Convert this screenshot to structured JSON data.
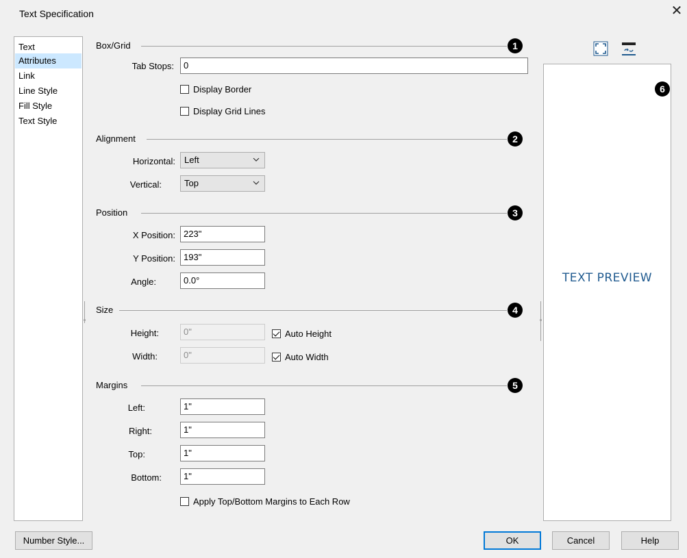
{
  "window": {
    "title": "Text Specification",
    "close_glyph": "✕"
  },
  "sidebar": {
    "items": [
      {
        "label": "Text"
      },
      {
        "label": "Attributes",
        "selected": true
      },
      {
        "label": "Link"
      },
      {
        "label": "Line Style"
      },
      {
        "label": "Fill Style"
      },
      {
        "label": "Text Style"
      }
    ]
  },
  "box_grid": {
    "heading": "Box/Grid",
    "badge": "1",
    "tab_stops_label": "Tab Stops:",
    "tab_stops_value": "0",
    "display_border_label": "Display Border",
    "display_border_checked": false,
    "display_grid_lines_label": "Display Grid Lines",
    "display_grid_lines_checked": false
  },
  "alignment": {
    "heading": "Alignment",
    "badge": "2",
    "horizontal_label": "Horizontal:",
    "horizontal_value": "Left",
    "vertical_label": "Vertical:",
    "vertical_value": "Top"
  },
  "position": {
    "heading": "Position",
    "badge": "3",
    "x_label": "X Position:",
    "x_value": "223\"",
    "y_label": "Y Position:",
    "y_value": "193\"",
    "angle_label": "Angle:",
    "angle_value": "0.0°"
  },
  "size": {
    "heading": "Size",
    "badge": "4",
    "height_label": "Height:",
    "height_value": "0\"",
    "auto_height_label": "Auto Height",
    "auto_height_checked": true,
    "width_label": "Width:",
    "width_value": "0\"",
    "auto_width_label": "Auto Width",
    "auto_width_checked": true
  },
  "margins": {
    "heading": "Margins",
    "badge": "5",
    "left_label": "Left:",
    "left_value": "1\"",
    "right_label": "Right:",
    "right_value": "1\"",
    "top_label": "Top:",
    "top_value": "1\"",
    "bottom_label": "Bottom:",
    "bottom_value": "1\"",
    "apply_each_row_label": "Apply Top/Bottom Margins to Each Row",
    "apply_each_row_checked": false
  },
  "preview": {
    "badge": "6",
    "text": "TEXT PREVIEW",
    "fill_icon": "fill-window-icon",
    "swap_icon": "reverse-preview-icon"
  },
  "buttons": {
    "number_style": "Number Style...",
    "ok": "OK",
    "cancel": "Cancel",
    "help": "Help"
  },
  "colors": {
    "selection": "#cce8ff",
    "default_button_border": "#0078d7",
    "preview_text": "#1f5a8f"
  }
}
